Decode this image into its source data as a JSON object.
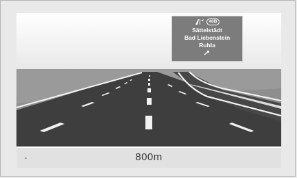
{
  "guidance": {
    "route_badge": "40B",
    "destinations": [
      "Sättelstädt",
      "Bad Liebenstein",
      "Ruhla"
    ],
    "distance": "800m"
  },
  "colors": {
    "sign_background": "#7c7c7c",
    "road": "#3f3f3f",
    "bottom_bar": "#e1e1e1"
  },
  "icons": {
    "motorway": "motorway-exit-icon",
    "arrow": "up-right-arrow-icon"
  }
}
